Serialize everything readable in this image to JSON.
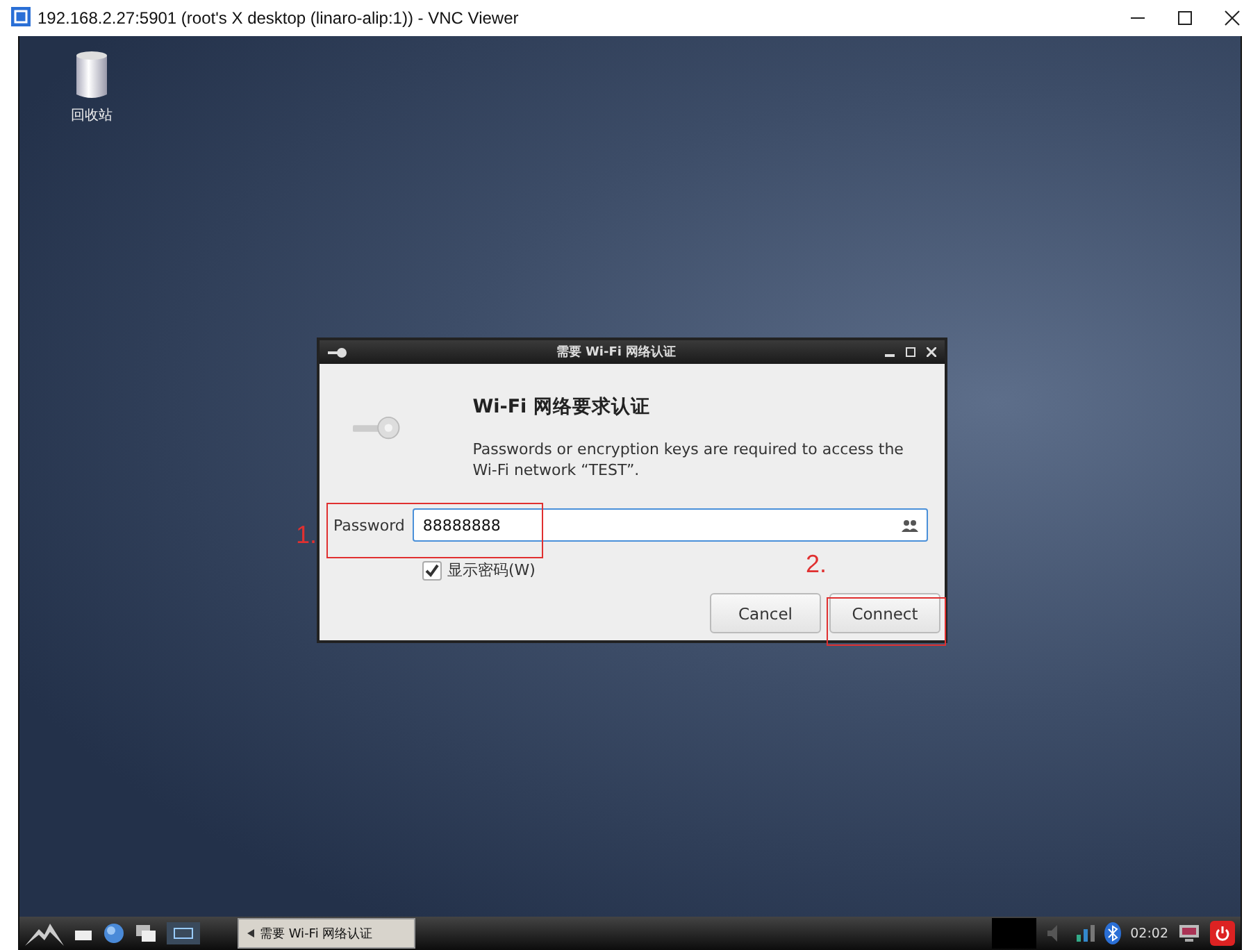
{
  "window": {
    "title": "192.168.2.27:5901 (root's X desktop (linaro-alip:1)) - VNC Viewer"
  },
  "desktop_icons": [
    {
      "label": "回收站"
    }
  ],
  "dialog": {
    "title": "需要 Wi-Fi 网络认证",
    "heading": "Wi-Fi 网络要求认证",
    "message": "Passwords or encryption keys are required to access the Wi-Fi network “TEST”.",
    "password_label": "Password",
    "password_value": "88888888",
    "show_password": {
      "label": "显示密码(W)",
      "checked": true
    },
    "buttons": [
      "Cancel",
      "Connect"
    ]
  },
  "annotations": [
    {
      "label": "1."
    },
    {
      "label": "2."
    }
  ],
  "taskbar": {
    "tasks": [
      {
        "label": "需要 Wi-Fi 网络认证"
      }
    ],
    "clock": "02:02"
  }
}
